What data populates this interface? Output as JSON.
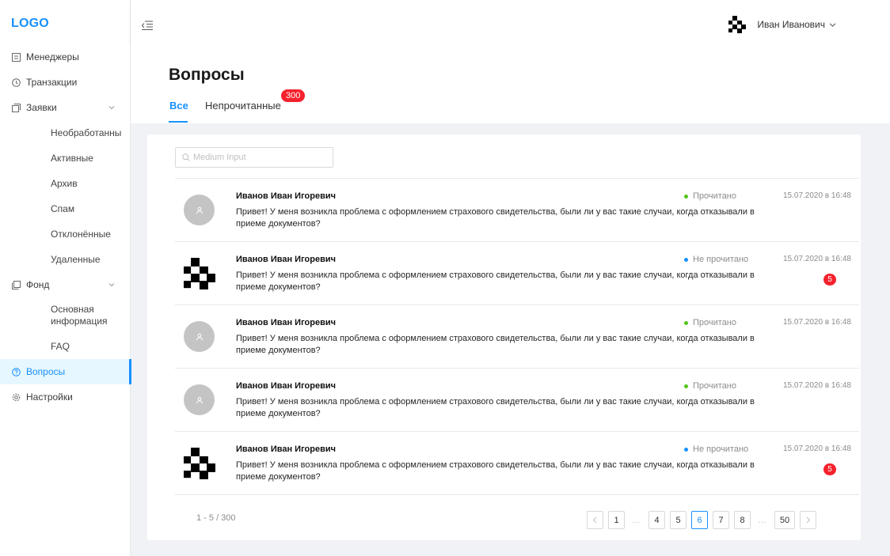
{
  "sidebar": {
    "logo": "LOGO",
    "items": [
      {
        "label": "Менеджеры",
        "icon": "list-icon"
      },
      {
        "label": "Транзакции",
        "icon": "clock-icon"
      },
      {
        "label": "Заявки",
        "icon": "copy-icon",
        "expanded": true,
        "children": [
          "Необработанны",
          "Активные",
          "Архив",
          "Спам",
          "Отклонённые",
          "Удаленные"
        ]
      },
      {
        "label": "Фонд",
        "icon": "file-copy-icon",
        "expanded": true,
        "children": [
          "Основная информация",
          "FAQ"
        ]
      },
      {
        "label": "Вопросы",
        "icon": "question-circle-icon",
        "active": true
      },
      {
        "label": "Настройки",
        "icon": "gear-icon"
      }
    ]
  },
  "header": {
    "user_name": "Иван Иванович"
  },
  "page": {
    "title": "Вопросы",
    "tabs": [
      {
        "label": "Все",
        "active": true
      },
      {
        "label": "Непрочитанные",
        "badge": "300"
      }
    ]
  },
  "search": {
    "placeholder": "Medium Input",
    "value": ""
  },
  "messages": [
    {
      "name": "Иванов Иван Игоревич",
      "text": "Привет! У меня возникла проблема с оформлением страхового свидетельства, были ли у вас такие случаи, когда отказывали в приеме документов?",
      "status": "Прочитано",
      "date": "15.07.2020 в 16:48",
      "avatar": "placeholder",
      "count": ""
    },
    {
      "name": "Иванов Иван Игоревич",
      "text": "Привет! У меня возникла проблема с оформлением страхового свидетельства, были ли у вас такие случаи, когда отказывали в приеме документов?",
      "status": "Не прочитано",
      "date": "15.07.2020 в 16:48",
      "avatar": "checker",
      "count": "5"
    },
    {
      "name": "Иванов Иван Игоревич",
      "text": "Привет! У меня возникла проблема с оформлением страхового свидетельства, были ли у вас такие случаи, когда отказывали в приеме документов?",
      "status": "Прочитано",
      "date": "15.07.2020 в 16:48",
      "avatar": "placeholder",
      "count": ""
    },
    {
      "name": "Иванов Иван Игоревич",
      "text": "Привет! У меня возникла проблема с оформлением страхового свидетельства, были ли у вас такие случаи, когда отказывали в приеме документов?",
      "status": "Прочитано",
      "date": "15.07.2020 в 16:48",
      "avatar": "placeholder",
      "count": ""
    },
    {
      "name": "Иванов Иван Игоревич",
      "text": "Привет! У меня возникла проблема с оформлением страхового свидетельства, были ли у вас такие случаи, когда отказывали в приеме документов?",
      "status": "Не прочитано",
      "date": "15.07.2020 в 16:48",
      "avatar": "checker",
      "count": "5"
    }
  ],
  "pagination": {
    "range": "1 - 5 / 300",
    "pages": [
      "1",
      "…",
      "4",
      "5",
      "6",
      "7",
      "8",
      "…",
      "50"
    ],
    "current": "6"
  },
  "colors": {
    "accent": "#1890ff",
    "badge": "#f5222d",
    "read_dot": "#52c41a",
    "unread_dot": "#1890ff"
  }
}
